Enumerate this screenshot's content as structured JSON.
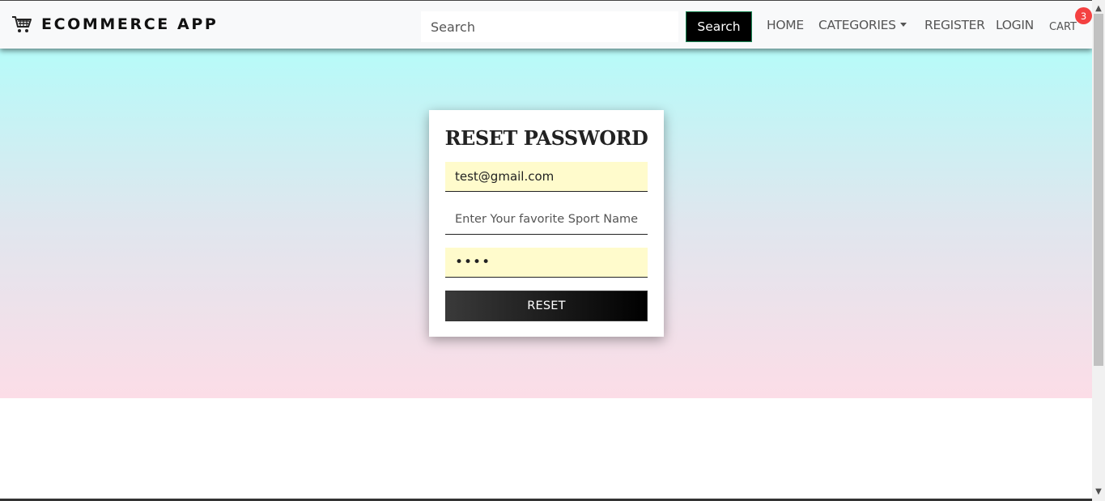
{
  "navbar": {
    "brand": "ECOMMERCE APP",
    "brand_icon": "shopping-cart-icon",
    "search_placeholder": "Search",
    "search_button": "Search",
    "links": {
      "home": "HOME",
      "categories": "CATEGORIES",
      "register": "REGISTER",
      "login": "LOGIN",
      "cart": "CART"
    },
    "cart_count": "3"
  },
  "form": {
    "title": "RESET PASSWORD",
    "email_value": "test@gmail.com",
    "sport_placeholder": "Enter Your favorite Sport Name",
    "password_value": "1234",
    "reset_button": "RESET"
  },
  "colors": {
    "gradient_top": "#b6fbf9",
    "gradient_bottom": "#fcdde7",
    "autofill_background": "#fffbcc",
    "badge": "#f44141",
    "button_dark": "#000000"
  }
}
